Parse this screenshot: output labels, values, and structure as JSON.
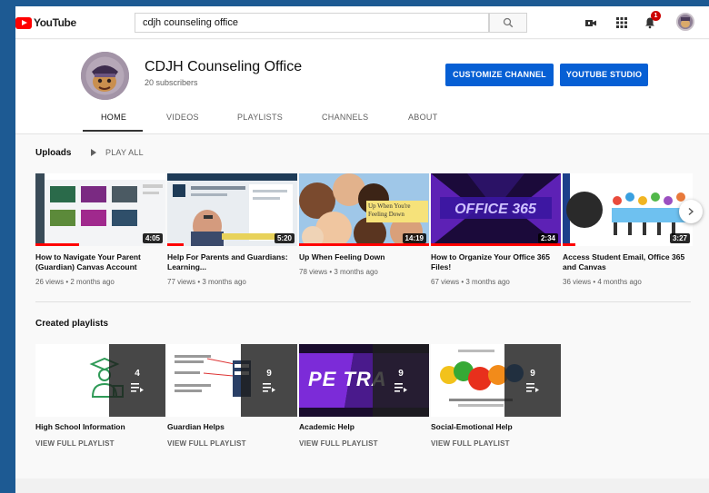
{
  "topbar": {
    "logo_text": "YouTube",
    "search_value": "cdjh counseling office",
    "notification_count": "1",
    "icons": [
      "search-icon",
      "video-camera-icon",
      "apps-grid-icon",
      "bell-icon"
    ]
  },
  "channel": {
    "name": "CDJH Counseling Office",
    "subscribers": "20 subscribers",
    "customize_label": "CUSTOMIZE CHANNEL",
    "studio_label": "YOUTUBE STUDIO",
    "tabs": [
      "HOME",
      "VIDEOS",
      "PLAYLISTS",
      "CHANNELS",
      "ABOUT"
    ],
    "active_tab": "HOME"
  },
  "uploads": {
    "title": "Uploads",
    "play_all": "PLAY ALL",
    "videos": [
      {
        "title": "How to Navigate Your Parent (Guardian) Canvas Account",
        "meta": "26 views • 2 months ago",
        "duration": "4:05"
      },
      {
        "title": "Help For Parents and Guardians: Learning...",
        "meta": "77 views • 3 months ago",
        "duration": "5:20"
      },
      {
        "title": "Up When Feeling Down",
        "meta": "78 views • 3 months ago",
        "duration": "14:19",
        "thumb_text": "Up When You're Feeling Down"
      },
      {
        "title": "How to Organize Your Office 365 Files!",
        "meta": "67 views • 3 months ago",
        "duration": "2:34"
      },
      {
        "title": "Access Student Email, Office 365 and Canvas",
        "meta": "36 views • 4 months ago",
        "duration": "3:27"
      }
    ]
  },
  "playlists": {
    "title": "Created playlists",
    "items": [
      {
        "title": "High School Information",
        "count": "4",
        "link": "VIEW FULL PLAYLIST"
      },
      {
        "title": "Guardian Helps",
        "count": "9",
        "link": "VIEW FULL PLAYLIST"
      },
      {
        "title": "Academic Help",
        "count": "9",
        "link": "VIEW FULL PLAYLIST",
        "thumb_text": "PE TRA"
      },
      {
        "title": "Social-Emotional Help",
        "count": "9",
        "link": "VIEW FULL PLAYLIST"
      }
    ]
  },
  "colors": {
    "accent_blue": "#065fd4",
    "youtube_red": "#ff0000",
    "desktop_bg": "#1d5a93"
  }
}
